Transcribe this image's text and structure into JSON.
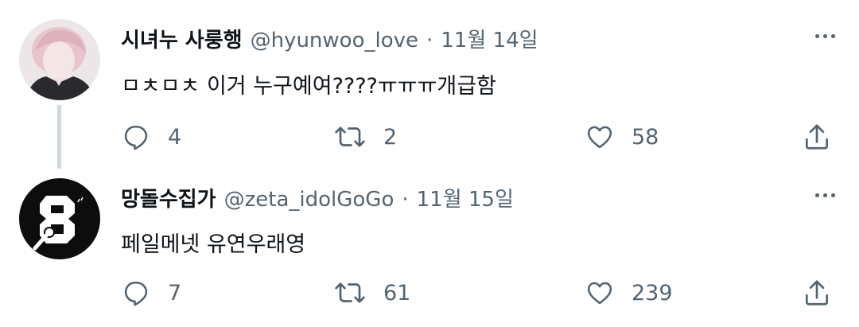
{
  "tweets": [
    {
      "name": "시녀누 사룽행",
      "handle": "@hyunwoo_love",
      "separator": "·",
      "date": "11월 14일",
      "text": "ㅁㅊㅁㅊ 이거 누구예여????ㅠㅠㅠ개급함",
      "replies": "4",
      "retweets": "2",
      "likes": "58"
    },
    {
      "name": "망돌수집가",
      "handle": "@zeta_idolGoGo",
      "separator": "·",
      "date": "11월 15일",
      "text": "페일메넷 유연우래영",
      "replies": "7",
      "retweets": "61",
      "likes": "239"
    }
  ],
  "icons": {
    "reply": "reply-icon",
    "retweet": "retweet-icon",
    "like": "heart-icon",
    "share": "share-icon",
    "more": "more-icon"
  },
  "colors": {
    "text": "#0f1419",
    "secondary": "#536471",
    "thread_line": "#cfd9de"
  }
}
